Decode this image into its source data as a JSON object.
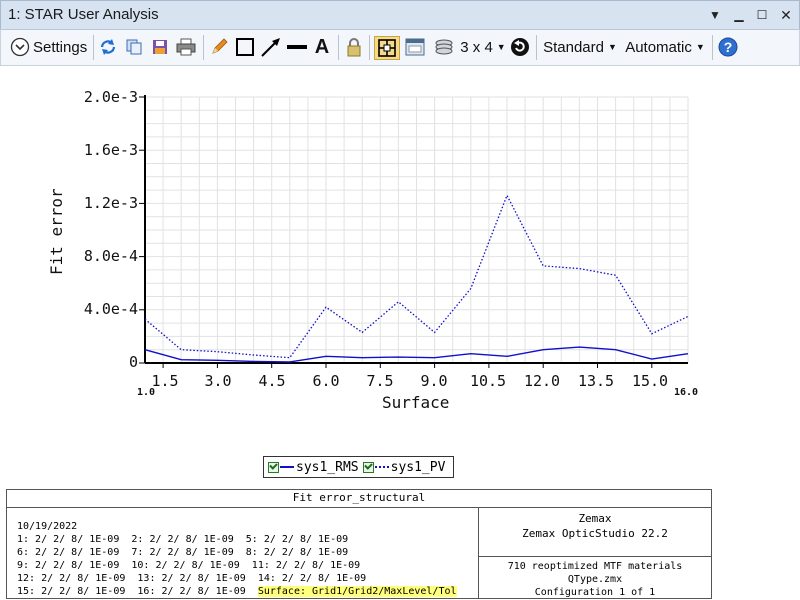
{
  "window": {
    "title": "1: STAR User Analysis"
  },
  "toolbar": {
    "settings_label": "Settings",
    "layout_label": "3 x 4",
    "standard_label": "Standard",
    "automatic_label": "Automatic"
  },
  "chart_data": {
    "type": "line",
    "xlabel": "Surface",
    "ylabel": "Fit error",
    "x": [
      1,
      2,
      3,
      4,
      5,
      6,
      7,
      8,
      9,
      10,
      11,
      12,
      13,
      14,
      15,
      16
    ],
    "xlim": [
      1.0,
      16.0
    ],
    "ylim": [
      0,
      0.002
    ],
    "yticks": [
      "2.0e-3",
      "1.6e-3",
      "1.2e-3",
      "8.0e-4",
      "4.0e-4",
      "0"
    ],
    "xticks": [
      "1.5",
      "3.0",
      "4.5",
      "6.0",
      "7.5",
      "9.0",
      "10.5",
      "12.0",
      "13.5",
      "15.0"
    ],
    "xtick_min_label": "1.0",
    "xtick_max_label": "16.0",
    "grid": true,
    "series": [
      {
        "name": "sys1_RMS",
        "style": "solid",
        "color": "#1010c8",
        "values": [
          0.0001,
          2.5e-05,
          2e-05,
          1.2e-05,
          8e-06,
          5e-05,
          4e-05,
          4.5e-05,
          4e-05,
          7e-05,
          5e-05,
          0.0001,
          0.00012,
          0.0001,
          3e-05,
          7e-05
        ]
      },
      {
        "name": "sys1_PV",
        "style": "dotted",
        "color": "#1010c8",
        "values": [
          0.00033,
          0.0001,
          8.5e-05,
          6e-05,
          4e-05,
          0.00042,
          0.00023,
          0.00046,
          0.00023,
          0.00056,
          0.00126,
          0.00073,
          0.00071,
          0.00066,
          0.00022,
          0.00035
        ]
      }
    ]
  },
  "info_panel": {
    "title": "Fit error_structural",
    "lines": [
      "10/19/2022",
      "1: 2/ 2/ 8/ 1E-09  2: 2/ 2/ 8/ 1E-09  5: 2/ 2/ 8/ 1E-09",
      "6: 2/ 2/ 8/ 1E-09  7: 2/ 2/ 8/ 1E-09  8: 2/ 2/ 8/ 1E-09",
      "9: 2/ 2/ 8/ 1E-09  10: 2/ 2/ 8/ 1E-09  11: 2/ 2/ 8/ 1E-09",
      "12: 2/ 2/ 8/ 1E-09  13: 2/ 2/ 8/ 1E-09  14: 2/ 2/ 8/ 1E-09",
      "15: 2/ 2/ 8/ 1E-09  16: 2/ 2/ 8/ 1E-09  "
    ],
    "highlight": "Surface: Grid1/Grid2/MaxLevel/Tol",
    "company": "Zemax",
    "product": "Zemax OpticStudio 22.2",
    "file": "710 reoptimized MTF materials QType.zmx",
    "configuration": "Configuration 1 of 1"
  }
}
